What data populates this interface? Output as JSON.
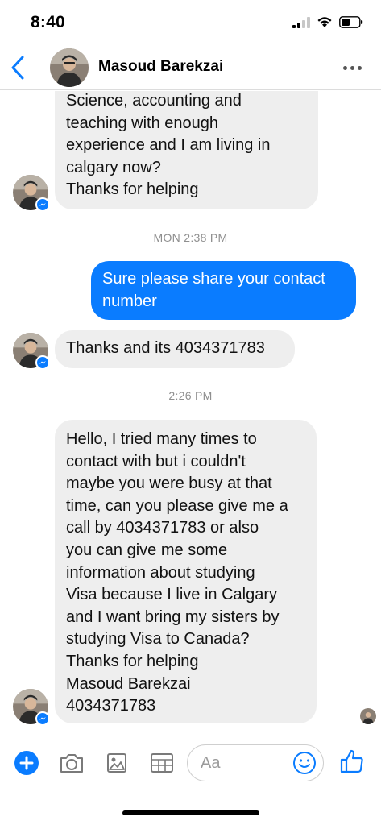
{
  "status_bar": {
    "time": "8:40"
  },
  "header": {
    "contact_name": "Masoud Barekzai"
  },
  "messages": [
    {
      "from": "contact",
      "lines": [
        "Science, accounting and",
        "teaching with enough",
        "experience and I am living in",
        "calgary now?",
        "Thanks for helping"
      ]
    },
    {
      "timestamp": "MON 2:38 PM"
    },
    {
      "from": "me",
      "lines": [
        "Sure please share your contact",
        "number"
      ]
    },
    {
      "from": "contact",
      "lines": [
        "Thanks and its 4034371783"
      ]
    },
    {
      "timestamp": "2:26 PM"
    },
    {
      "from": "contact",
      "lines": [
        "Hello, I tried many times to",
        "contact with but i couldn't",
        "maybe you were busy at that",
        "time, can you please give me a",
        "call by 4034371783 or also",
        "you can give me some",
        "information about studying",
        "Visa because I live in Calgary",
        "and  I want bring my sisters by",
        "studying Visa to Canada?",
        "Thanks for helping",
        "Masoud Barekzai",
        "4034371783"
      ]
    }
  ],
  "composer": {
    "placeholder": "Aa"
  },
  "colors": {
    "accent": "#0a7cff",
    "incoming_bubble": "#eeeeee",
    "timestamp": "#8f8f8f"
  },
  "icons": [
    "back-arrow-icon",
    "more-options-icon",
    "plus-icon",
    "camera-icon",
    "gallery-icon",
    "sticker-grid-icon",
    "emoji-icon",
    "like-thumb-icon",
    "messenger-badge-icon"
  ]
}
